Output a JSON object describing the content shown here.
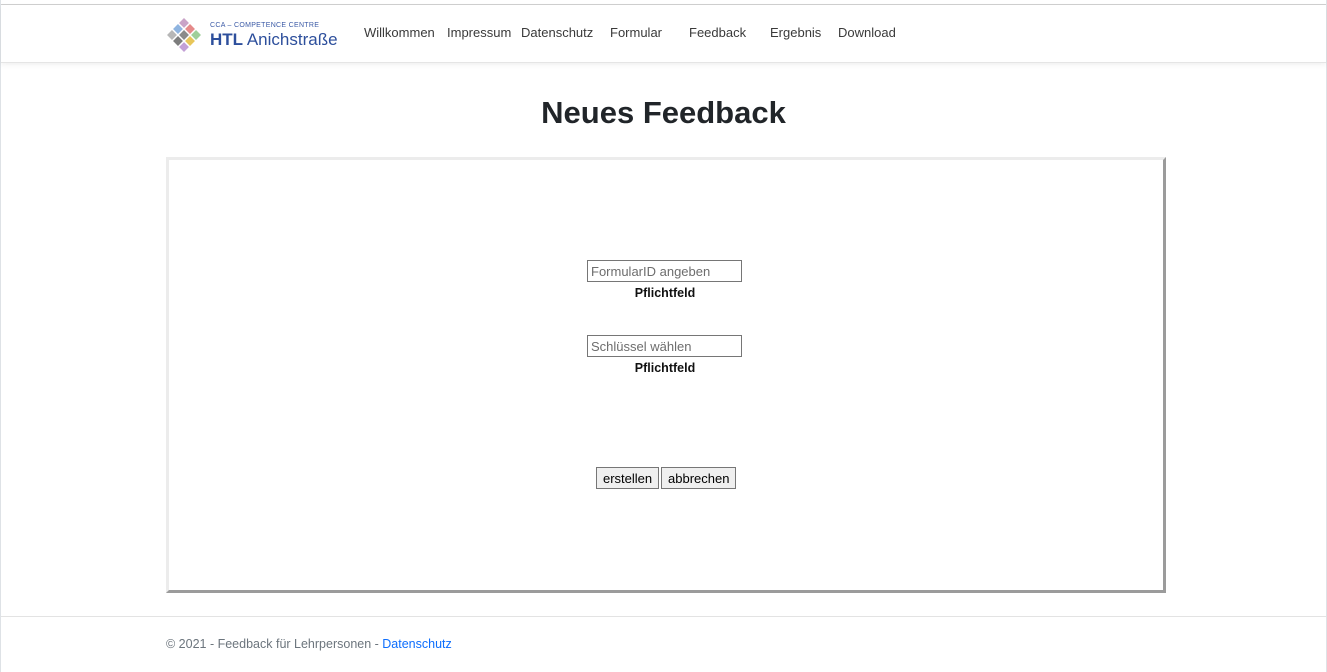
{
  "brand": {
    "small_text": "CCA – COMPETENCE CENTRE",
    "name_bold": "HTL",
    "name_rest": " Anichstraße",
    "logo_colors": [
      "#c9a3c7",
      "#e58a8a",
      "#9fcf9a",
      "#8fb4e0",
      "#8a8a8a",
      "#e8c65a",
      "#b7b7b7",
      "#7d7d7d",
      "#c3a0d6"
    ]
  },
  "nav": {
    "items": [
      {
        "label": "Willkommen"
      },
      {
        "label": "Impressum"
      },
      {
        "label": "Datenschutz"
      },
      {
        "label": "Formular"
      },
      {
        "label": "Feedback"
      },
      {
        "label": "Ergebnis"
      },
      {
        "label": "Download"
      }
    ]
  },
  "page": {
    "title": "Neues Feedback"
  },
  "form": {
    "formular_id": {
      "value": "",
      "placeholder": "FormularID angeben",
      "required_label": "Pflichtfeld"
    },
    "key": {
      "value": "",
      "placeholder": "Schlüssel wählen",
      "required_label": "Pflichtfeld"
    },
    "create_label": "erstellen",
    "cancel_label": "abbrechen"
  },
  "footer": {
    "text": "© 2021 - Feedback für Lehrpersonen - ",
    "link_label": "Datenschutz"
  },
  "colors": {
    "link": "#0d6efd",
    "brand_blue": "#2d4f9c"
  }
}
